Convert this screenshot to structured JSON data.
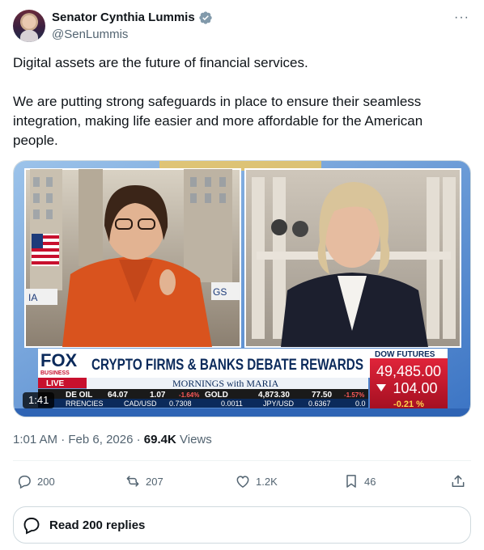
{
  "author": {
    "name": "Senator Cynthia Lummis",
    "handle": "@SenLummis",
    "verified": true,
    "verified_color": "#829aab"
  },
  "more_menu": {
    "icon": "more-horizontal-icon",
    "label": "···"
  },
  "tweet": {
    "paragraphs": [
      "Digital assets are the future of financial services.",
      "We are putting strong safeguards in place to ensure their seamless integration, making life easier and more affordable for the American people."
    ]
  },
  "video": {
    "duration": "1:41",
    "network_logo": "FOX",
    "network_sub": "BUSINESS",
    "live_label": "LIVE",
    "headline": "CRYPTO FIRMS & BANKS DEBATE REWARDS",
    "show_name": "MORNINGS with MARIA",
    "dow": {
      "label": "DOW FUTURES",
      "value": "49,485.00",
      "change": "104.00",
      "change_pct": "-0.21 %"
    },
    "ticker": [
      "DE OIL",
      "64.07",
      "1.07",
      "-1.64%",
      "GOLD",
      "4,873.30",
      "77.50",
      "-1.57%"
    ],
    "ticker2": [
      "RRENCIES",
      "CAD/USD",
      "0.7308",
      "0.0011",
      "JPY/USD",
      "0.6367",
      "0.0"
    ],
    "bg_signs": [
      "IA",
      "GS"
    ]
  },
  "meta": {
    "time": "1:01 AM",
    "separator": "·",
    "date": "Feb 6, 2026",
    "views_count": "69.4K",
    "views_label": "Views"
  },
  "actions": {
    "replies": "200",
    "reposts": "207",
    "likes": "1.2K",
    "bookmarks": "46"
  },
  "read_replies_label": "Read 200 replies",
  "colors": {
    "text": "#0f1419",
    "muted": "#536471",
    "border": "#cfd9de",
    "fox_red": "#c8102e",
    "fox_navy": "#0b2a5b"
  }
}
